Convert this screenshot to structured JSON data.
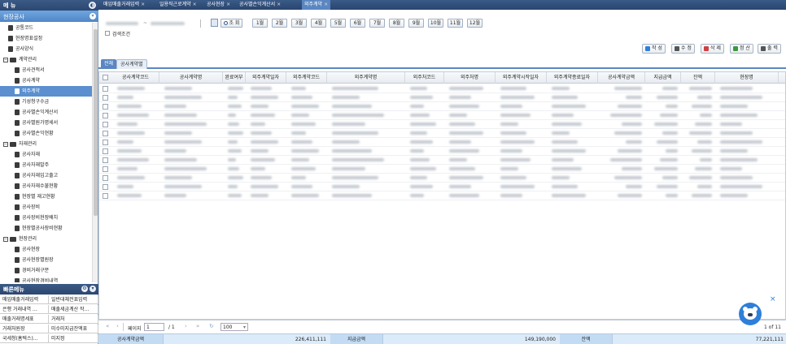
{
  "sidebar": {
    "header": "메 뉴",
    "header_toggle": "◐",
    "section": "현장공사",
    "section_toggle": "▾",
    "tree": [
      {
        "label": "공통코드",
        "level": 1,
        "type": "item"
      },
      {
        "label": "현장명표설정",
        "level": 1,
        "type": "item"
      },
      {
        "label": "공사양식",
        "level": 1,
        "type": "item"
      },
      {
        "label": "계약관리",
        "level": 0,
        "type": "folder"
      },
      {
        "label": "공사견적서",
        "level": 2,
        "type": "item"
      },
      {
        "label": "공사계약",
        "level": 2,
        "type": "item"
      },
      {
        "label": "외주계약",
        "level": 2,
        "type": "item",
        "selected": true
      },
      {
        "label": "기성청구수금",
        "level": 2,
        "type": "item"
      },
      {
        "label": "공사별손익계산서",
        "level": 2,
        "type": "item"
      },
      {
        "label": "공사별원가명세서",
        "level": 2,
        "type": "item"
      },
      {
        "label": "공사별손익현황",
        "level": 2,
        "type": "item"
      },
      {
        "label": "자재관리",
        "level": 0,
        "type": "folder"
      },
      {
        "label": "공사자재",
        "level": 2,
        "type": "item"
      },
      {
        "label": "공사자재발주",
        "level": 2,
        "type": "item"
      },
      {
        "label": "공사자재입고출고",
        "level": 2,
        "type": "item"
      },
      {
        "label": "공사자재수불현황",
        "level": 2,
        "type": "item"
      },
      {
        "label": "현장별 재고현황",
        "level": 2,
        "type": "item"
      },
      {
        "label": "공사장비",
        "level": 2,
        "type": "item"
      },
      {
        "label": "공사장비현장배치",
        "level": 2,
        "type": "item"
      },
      {
        "label": "현장별공사장비현황",
        "level": 2,
        "type": "item"
      },
      {
        "label": "현장관리",
        "level": 0,
        "type": "folder"
      },
      {
        "label": "공사현장",
        "level": 2,
        "type": "item"
      },
      {
        "label": "공사현장별원장",
        "level": 2,
        "type": "item"
      },
      {
        "label": "경비거래구분",
        "level": 2,
        "type": "item"
      },
      {
        "label": "공사현장경비내역",
        "level": 2,
        "type": "item"
      }
    ],
    "favorites_header": "빠른메뉴",
    "favorites": [
      [
        "매입매출거래입력",
        "일반대체전표입력"
      ],
      [
        "은행 거래내역 …",
        "매출세금계산 작…"
      ],
      [
        "매출거래명세표",
        "거래처"
      ],
      [
        "거래처원장",
        "미수미지급잔액표"
      ],
      [
        "국세청(홈텍스)…",
        "미지정"
      ]
    ]
  },
  "tabs": [
    {
      "label": "매입매출거래입력",
      "active": false
    },
    {
      "label": "일용직근로계약",
      "active": false
    },
    {
      "label": "공사현장",
      "active": false
    },
    {
      "label": "공사별손익계산서",
      "active": false
    },
    {
      "label": "외주계약",
      "active": true
    }
  ],
  "toolbar": {
    "search_button": "조 회",
    "months": [
      "1월",
      "2월",
      "3월",
      "4월",
      "5월",
      "6월",
      "7월",
      "8월",
      "9월",
      "10월",
      "11월",
      "12월"
    ],
    "search_cond_label": "검색조건",
    "actions": [
      {
        "label": "작 성",
        "icon": "plus-icon",
        "color": "#2f7fd9"
      },
      {
        "label": "수 정",
        "icon": "edit-icon",
        "color": "#555555"
      },
      {
        "label": "삭 제",
        "icon": "trash-icon",
        "color": "#d04040"
      },
      {
        "label": "정 산",
        "icon": "settle-icon",
        "color": "#3a9a3a"
      },
      {
        "label": "출 력",
        "icon": "print-icon",
        "color": "#555555"
      }
    ]
  },
  "subtabs": [
    "전체",
    "공사계약별"
  ],
  "grid": {
    "columns": [
      "공사계약코드",
      "공사계약명",
      "완료여부",
      "외주계약일자",
      "외주계약코드",
      "외주계약명",
      "외주처코드",
      "외주처명",
      "외주계약시작일자",
      "외주계약종료일자",
      "공사계약금액",
      "지급금액",
      "잔액",
      "현장명"
    ],
    "row_count": 13
  },
  "pager": {
    "page_label": "페이지",
    "page": "1",
    "total": "/ 1",
    "page_size": "100",
    "info": "1 of 11"
  },
  "summary": {
    "contract_label": "공사계약금액",
    "contract_value": "226,411,111",
    "paid_label": "지급금액",
    "paid_value": "149,190,000",
    "balance_label": "잔액",
    "balance_value": "77,221,111"
  }
}
